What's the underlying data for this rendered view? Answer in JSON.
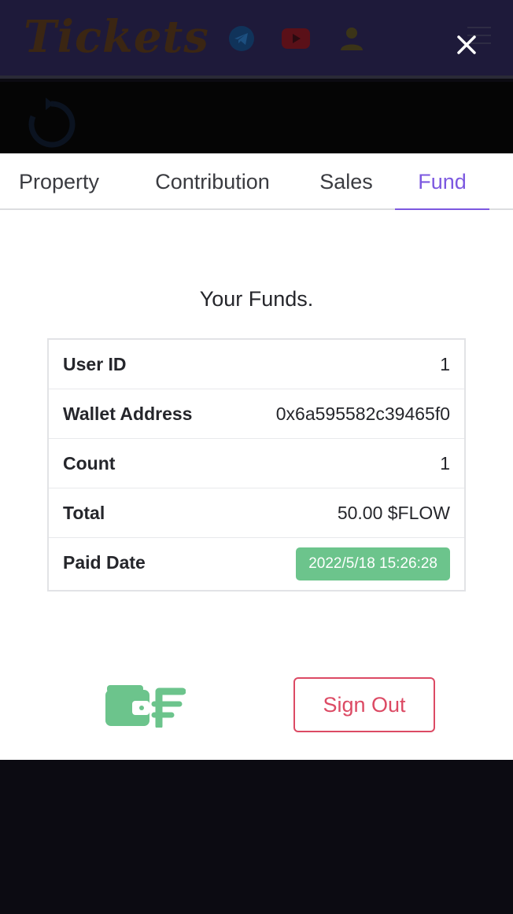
{
  "app": {
    "brand": "Tickets"
  },
  "icons": {
    "telegram": "telegram-icon",
    "youtube": "youtube-icon",
    "user": "user-icon",
    "menu": "menu-icon",
    "close": "close-icon",
    "reload": "reload-icon",
    "wallet": "wallet-icon",
    "flow": "flow-icon"
  },
  "tabs": [
    {
      "label": "Property",
      "active": false
    },
    {
      "label": "Contribution",
      "active": false
    },
    {
      "label": "Sales",
      "active": false
    },
    {
      "label": "Fund",
      "active": true
    }
  ],
  "fund": {
    "title": "Your Funds.",
    "rows": [
      {
        "label": "User ID",
        "value": "1"
      },
      {
        "label": "Wallet Address",
        "value": "0x6a595582c39465f0"
      },
      {
        "label": "Count",
        "value": "1"
      },
      {
        "label": "Total",
        "value": "50.00 $FLOW"
      },
      {
        "label": "Paid Date",
        "value": "2022/5/18 15:26:28"
      }
    ]
  },
  "actions": {
    "sign_out": "Sign Out"
  },
  "colors": {
    "accent": "#7c58e0",
    "success": "#6cc48c",
    "danger": "#dc4a64",
    "header_bg": "#1e1a3a"
  }
}
